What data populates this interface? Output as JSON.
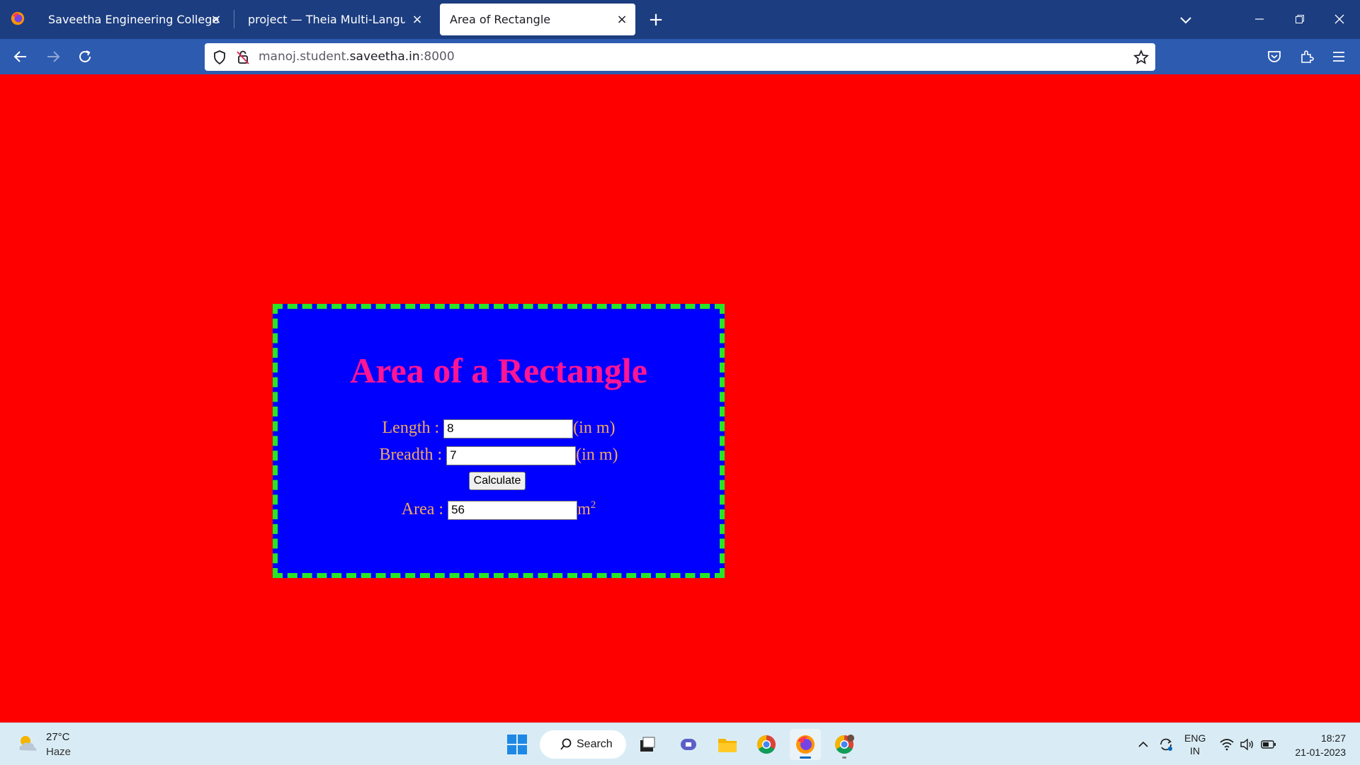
{
  "browser": {
    "tabs": [
      {
        "title": "Saveetha Engineering College",
        "active": false
      },
      {
        "title": "project — Theia Multi-Language Ex",
        "active": false
      },
      {
        "title": "Area of Rectangle",
        "active": true
      }
    ],
    "url_host": "manoj.student.",
    "url_domain": "saveetha.in",
    "url_port": ":8000"
  },
  "page": {
    "heading": "Area of a Rectangle",
    "length_label": "Length :",
    "length_value": "8",
    "length_unit": "(in m)",
    "breadth_label": "Breadth :",
    "breadth_value": "7",
    "breadth_unit": "(in m)",
    "calculate_label": "Calculate",
    "area_label": "Area :",
    "area_value": "56",
    "area_unit": "m",
    "area_unit_exp": "2",
    "colors": {
      "page_bg": "#ff0000",
      "card_bg": "#0000ff",
      "card_border": "#26e626",
      "heading": "#ff1493",
      "label": "#f0a85c"
    }
  },
  "taskbar": {
    "weather_temp": "27°C",
    "weather_desc": "Haze",
    "search_label": "Search",
    "lang_top": "ENG",
    "lang_bottom": "IN",
    "time": "18:27",
    "date": "21-01-2023",
    "apps": [
      "windows-start-icon",
      "task-view-icon",
      "teams-chat-icon",
      "file-explorer-icon",
      "chrome-icon",
      "firefox-icon",
      "chrome-profile-icon"
    ]
  }
}
